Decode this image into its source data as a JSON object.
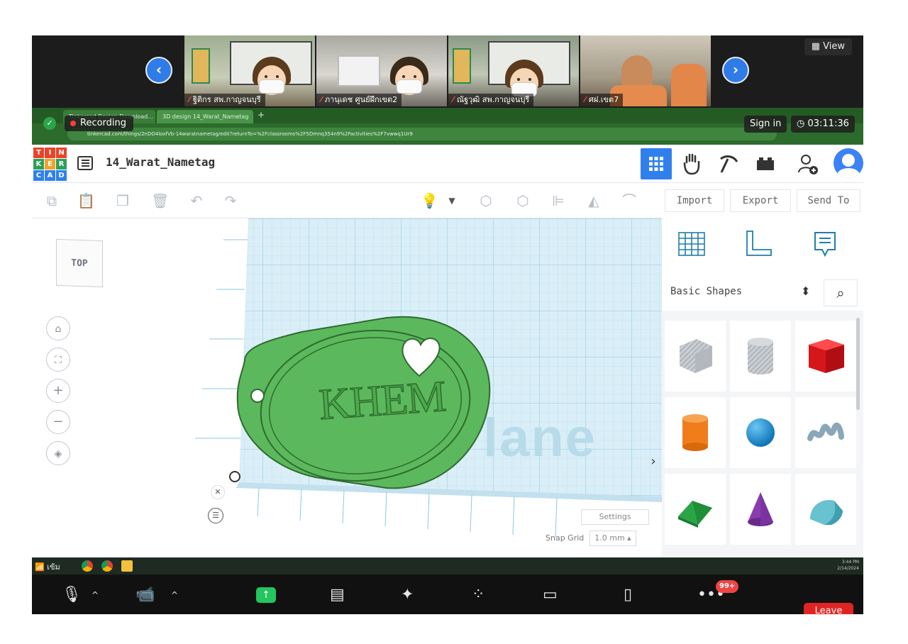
{
  "participants": [
    {
      "name": "ฐิติกร สพ.กาญจนบุรี"
    },
    {
      "name": "ภานุเดช ศูนย์ฝึกเขต2"
    },
    {
      "name": "ณัฐวุฒิ สพ.กาญจนบุรี"
    },
    {
      "name": "ศฝ.เขต7"
    }
  ],
  "zoom": {
    "view_label": "View",
    "recording_label": "Recording",
    "signin_label": "Sign in",
    "timer": "03:11:36",
    "unread_badge": "99+",
    "leave_label": "Leave"
  },
  "browser": {
    "tab1": "Tinkercad Design Download...",
    "tab2": "3D design 14_Warat_Nametag",
    "url": "tinkercad.com/things/2nDO4loxfVb-14waratnametag/edit?returnTo=%2Fclassrooms%2F5Dmnq354n9%2Factivities%2F7vwwq1Ur9"
  },
  "header": {
    "logo_letters": [
      "T",
      "I",
      "N",
      "K",
      "E",
      "R",
      "C",
      "A",
      "D"
    ],
    "design_title": "14_Warat_Nametag"
  },
  "toolbar": {
    "import_label": "Import",
    "export_label": "Export",
    "sendto_label": "Send To"
  },
  "workplane": {
    "viewcube_label": "TOP",
    "nametag_text": "KHEM",
    "plane_watermark": "lane",
    "settings_label": "Settings",
    "snap_grid_label": "Snap Grid",
    "snap_grid_value": "1.0 mm"
  },
  "shape_panel": {
    "category": "Basic Shapes",
    "shapes": [
      "box-hole",
      "cylinder-hole",
      "box",
      "cylinder",
      "sphere",
      "scribble",
      "roof",
      "cone",
      "round-roof"
    ]
  },
  "taskbar": {
    "network_label": "เข้ม",
    "time": "3:44 PM",
    "date": "2/14/2024"
  },
  "colors": {
    "accent_blue": "#2f80ed",
    "nametag_green": "#5cb85c",
    "grid_blue": "#c6e4f2",
    "record_red": "#ff3b3b"
  }
}
